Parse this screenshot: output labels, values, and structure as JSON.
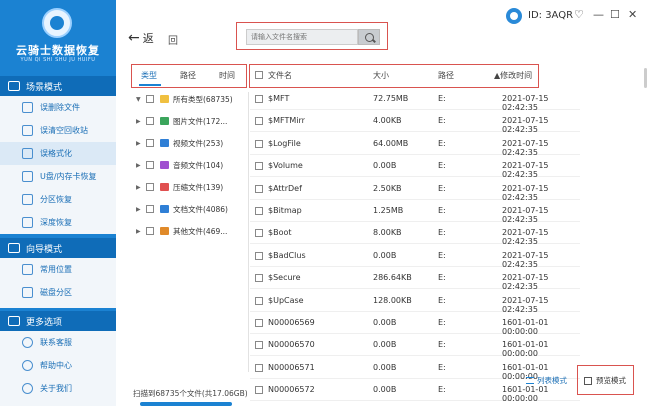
{
  "app": {
    "title": "云骑士数据恢复",
    "subtitle": "YUN QI SHI SHU JU HUIFU",
    "user_id": "ID: 3AQR",
    "window_controls": [
      "♡",
      "—",
      "☐",
      "✕"
    ]
  },
  "sidebar": {
    "sections": [
      {
        "title": "场景模式",
        "icon": "scene-icon",
        "items": [
          {
            "label": "误删除文件",
            "icon": "delete-file-icon",
            "active": false
          },
          {
            "label": "误清空回收站",
            "icon": "recycle-bin-icon",
            "active": false
          },
          {
            "label": "误格式化",
            "icon": "format-icon",
            "active": true
          },
          {
            "label": "U盘/内存卡恢复",
            "icon": "usb-icon",
            "active": false
          },
          {
            "label": "分区恢复",
            "icon": "partition-icon",
            "active": false
          },
          {
            "label": "深度恢复",
            "icon": "deep-scan-icon",
            "active": false
          }
        ]
      },
      {
        "title": "向导模式",
        "icon": "wizard-icon",
        "items": [
          {
            "label": "常用位置",
            "icon": "common-location-icon",
            "active": false
          },
          {
            "label": "磁盘分区",
            "icon": "disk-partition-icon",
            "active": false
          }
        ]
      },
      {
        "title": "更多选项",
        "icon": "more-options-icon",
        "items": [
          {
            "label": "联系客服",
            "icon": "support-icon",
            "active": false
          },
          {
            "label": "帮助中心",
            "icon": "help-icon",
            "active": false
          },
          {
            "label": "关于我们",
            "icon": "info-icon",
            "active": false
          }
        ]
      }
    ]
  },
  "toolbar": {
    "back_label": "返",
    "back_glyph": "←",
    "refresh_label": "回",
    "search_placeholder": "请输入文件名搜索"
  },
  "tabs": [
    {
      "label": "类型",
      "active": true
    },
    {
      "label": "路径",
      "active": false
    },
    {
      "label": "时间",
      "active": false
    }
  ],
  "columns": {
    "name": "文件名",
    "size": "大小",
    "path": "路径",
    "modified": "▲修改时间"
  },
  "tree": [
    {
      "caret": "▼",
      "label": "所有类型(68735)",
      "color": "#f0c040"
    },
    {
      "caret": "▶",
      "label": "图片文件(172...",
      "color": "#3ba55c"
    },
    {
      "caret": "▶",
      "label": "视频文件(253)",
      "color": "#2f7fd6"
    },
    {
      "caret": "▶",
      "label": "音频文件(104)",
      "color": "#a050d0"
    },
    {
      "caret": "▶",
      "label": "压缩文件(139)",
      "color": "#e05050"
    },
    {
      "caret": "▶",
      "label": "文档文件(4086)",
      "color": "#2f7fd6"
    },
    {
      "caret": "▶",
      "label": "其他文件(469...",
      "color": "#e08a2a"
    }
  ],
  "files": [
    {
      "name": "$MFT",
      "size": "72.75MB",
      "path": "E:",
      "modified": "2021-07-15 02:42:35"
    },
    {
      "name": "$MFTMirr",
      "size": "4.00KB",
      "path": "E:",
      "modified": "2021-07-15 02:42:35"
    },
    {
      "name": "$LogFile",
      "size": "64.00MB",
      "path": "E:",
      "modified": "2021-07-15 02:42:35"
    },
    {
      "name": "$Volume",
      "size": "0.00B",
      "path": "E:",
      "modified": "2021-07-15 02:42:35"
    },
    {
      "name": "$AttrDef",
      "size": "2.50KB",
      "path": "E:",
      "modified": "2021-07-15 02:42:35"
    },
    {
      "name": "$Bitmap",
      "size": "1.25MB",
      "path": "E:",
      "modified": "2021-07-15 02:42:35"
    },
    {
      "name": "$Boot",
      "size": "8.00KB",
      "path": "E:",
      "modified": "2021-07-15 02:42:35"
    },
    {
      "name": "$BadClus",
      "size": "0.00B",
      "path": "E:",
      "modified": "2021-07-15 02:42:35"
    },
    {
      "name": "$Secure",
      "size": "286.64KB",
      "path": "E:",
      "modified": "2021-07-15 02:42:35"
    },
    {
      "name": "$UpCase",
      "size": "128.00KB",
      "path": "E:",
      "modified": "2021-07-15 02:42:35"
    },
    {
      "name": "N00006569",
      "size": "0.00B",
      "path": "E:",
      "modified": "1601-01-01 00:00:00"
    },
    {
      "name": "N00006570",
      "size": "0.00B",
      "path": "E:",
      "modified": "1601-01-01 00:00:00"
    },
    {
      "name": "N00006571",
      "size": "0.00B",
      "path": "E:",
      "modified": "1601-01-01 00:00:00"
    },
    {
      "name": "N00006572",
      "size": "0.00B",
      "path": "E:",
      "modified": "1601-01-01 00:00:00"
    }
  ],
  "footer": {
    "status": "扫描到68735个文件(共17.06GB)",
    "list_mode": "列表模式",
    "preview_mode": "预览模式"
  }
}
